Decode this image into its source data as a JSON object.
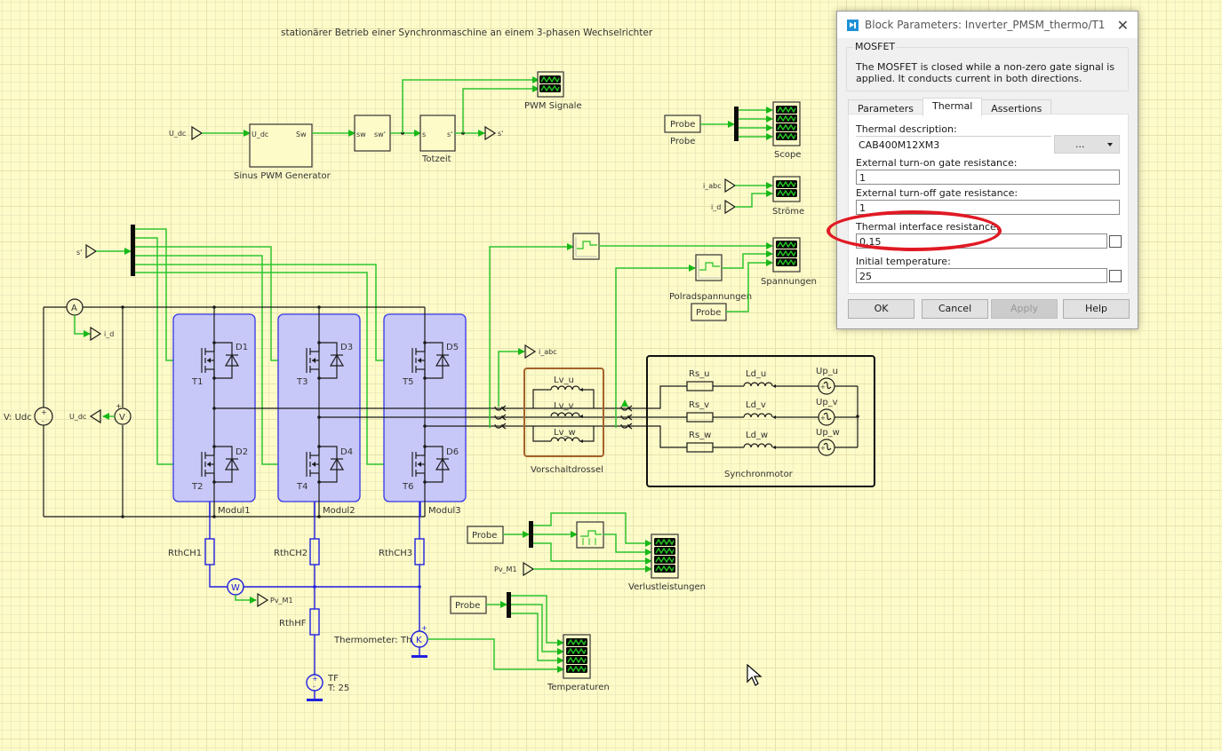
{
  "diagram": {
    "title": "stationärer Betrieb einer Synchronmaschine an einem 3-phasen Wechselrichter",
    "blocks": {
      "u_dc_in": "U_dc",
      "pwm_gen": {
        "label": "Sinus PWM Generator",
        "in": "U_dc",
        "out": "Sw"
      },
      "sw_block": {
        "in": "sw",
        "out": "sw'"
      },
      "totzeit": {
        "label": "Totzeit",
        "in": "s",
        "out": "s'"
      },
      "s_out": "s'",
      "pwm_scope": "PWM Signale",
      "s_in": "s'",
      "probe_scope": {
        "probe": "Probe",
        "probe_label": "Probe",
        "scope": "Scope"
      },
      "stroeme": {
        "in1": "i_abc",
        "in2": "i_d",
        "scope": "Ströme"
      },
      "spannungen": {
        "polrad": "Polradspannungen",
        "probe": "Probe",
        "scope": "Spannungen"
      },
      "ammeter": "A",
      "i_d_out": "i_d",
      "vsrc": "V: Udc",
      "voltmeter": "V",
      "u_dc_out": "U_dc",
      "transistors": [
        "T1",
        "T2",
        "T3",
        "T4",
        "T5",
        "T6"
      ],
      "diodes": [
        "D1",
        "D2",
        "D3",
        "D4",
        "D5",
        "D6"
      ],
      "modules": [
        "Modul1",
        "Modul2",
        "Modul3"
      ],
      "i_abc_out": "i_abc",
      "chokes": [
        "Lv_u",
        "Lv_v",
        "Lv_w"
      ],
      "choke_group": "Vorschaltdrossel",
      "motor": {
        "label": "Synchronmotor",
        "rs": [
          "Rs_u",
          "Rs_v",
          "Rs_w"
        ],
        "ld": [
          "Ld_u",
          "Ld_v",
          "Ld_w"
        ],
        "up": [
          "Up_u",
          "Up_v",
          "Up_w"
        ]
      },
      "thermal": {
        "rth": [
          "RthCH1",
          "RthCH2",
          "RthCH3"
        ],
        "rthhf": "RthHF",
        "wattmeter": "W",
        "pv_out": "Pv_M1",
        "thermometer_label": "Thermometer: Th",
        "thermometer": "K",
        "tf": "TF",
        "tf_value": "T: 25"
      },
      "verlust": {
        "probe": "Probe",
        "pv_in": "Pv_M1",
        "scope": "Verlustleistungen"
      },
      "temperaturen": {
        "probe": "Probe",
        "scope": "Temperaturen"
      }
    }
  },
  "dialog": {
    "title": "Block Parameters: Inverter_PMSM_thermo/T1",
    "group_label": "MOSFET",
    "description": "The MOSFET is closed while a non-zero gate signal is applied. It conducts current in both directions.",
    "tabs": [
      {
        "label": "Parameters",
        "active": false
      },
      {
        "label": "Thermal",
        "active": true
      },
      {
        "label": "Assertions",
        "active": false
      }
    ],
    "fields": {
      "thermal_description": {
        "label": "Thermal description:",
        "value": "CAB400M12XM3",
        "button": "..."
      },
      "turn_on": {
        "label": "External turn-on gate resistance:",
        "value": "1"
      },
      "turn_off": {
        "label": "External turn-off gate resistance:",
        "value": "1"
      },
      "interface": {
        "label": "Thermal interface resistance:",
        "value": "0.15",
        "checked": false
      },
      "initial_temp": {
        "label": "Initial temperature:",
        "value": "25",
        "checked": false
      }
    },
    "buttons": {
      "ok": "OK",
      "cancel": "Cancel",
      "apply": "Apply",
      "help": "Help"
    },
    "highlight_color": "#e01a24"
  }
}
